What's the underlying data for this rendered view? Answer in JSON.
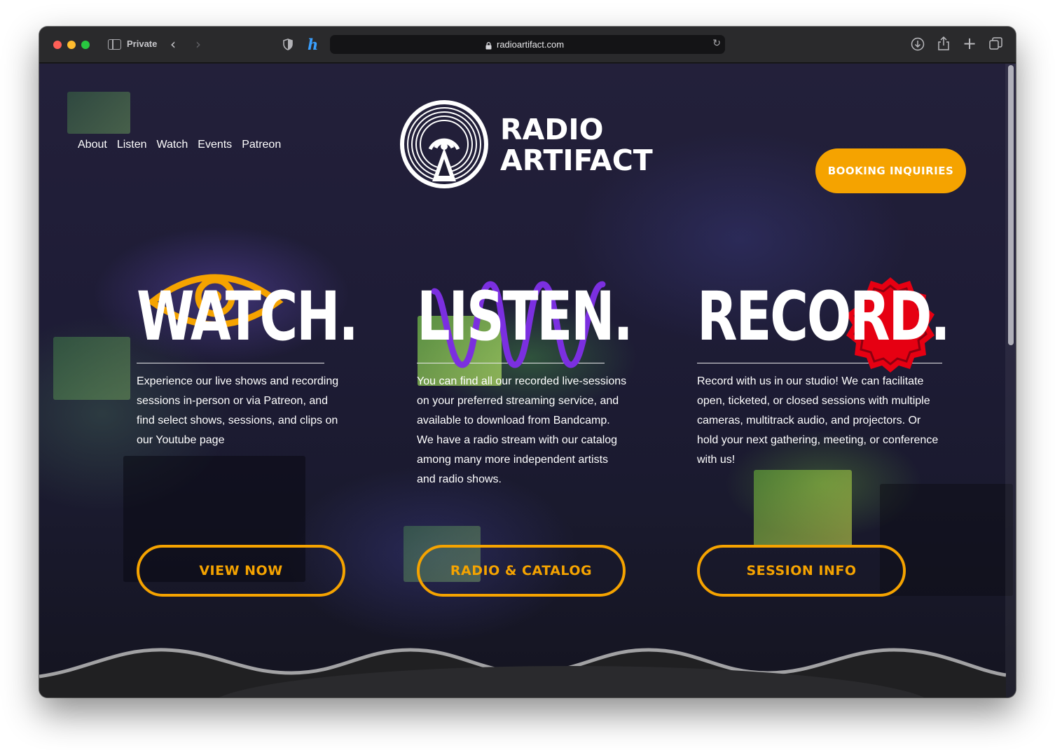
{
  "browser": {
    "private_label": "Private",
    "url": "radioartifact.com"
  },
  "site": {
    "nav": [
      "About",
      "Listen",
      "Watch",
      "Events",
      "Patreon"
    ],
    "logo": {
      "line1": "RADIO",
      "line2": "ARTIFACT"
    },
    "booking_label": "BOOKING INQUIRIES"
  },
  "columns": [
    {
      "title": "WATCH.",
      "body": "Experience our live shows and recording sessions in-person or via Patreon, and find select shows, sessions, and clips on our Youtube page",
      "button": "VIEW NOW"
    },
    {
      "title": "LISTEN.",
      "body": "You can find all our recorded live-sessions on your preferred streaming service, and available to download from Bandcamp. We have a radio stream with our catalog among many more independent artists and radio shows.",
      "button": "RADIO & CATALOG"
    },
    {
      "title": "RECORD.",
      "body": "Record with us in our studio! We can facilitate open, ticketed, or closed sessions with multiple cameras, multitrack audio, and projectors.  Or hold your next gathering, meeting, or conference with us!",
      "button": "SESSION INFO"
    }
  ],
  "colors": {
    "accent_orange": "#f5a300",
    "listen_purple": "#7b2fe0",
    "record_red": "#e60012"
  }
}
